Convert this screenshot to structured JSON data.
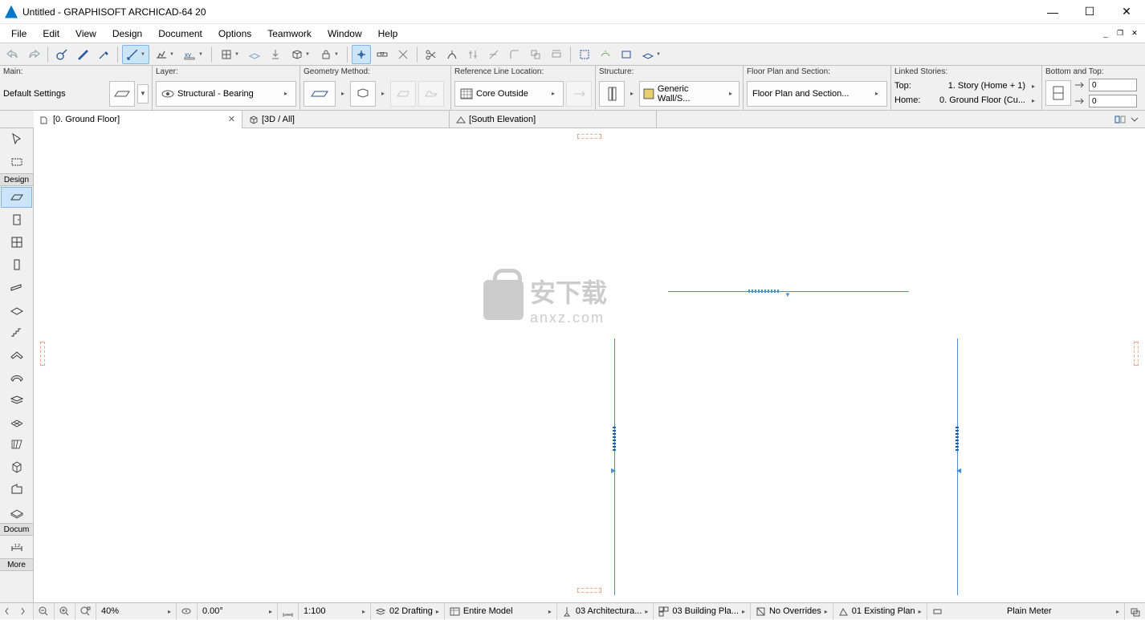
{
  "window": {
    "title": "Untitled - GRAPHISOFT ARCHICAD-64 20"
  },
  "menu": [
    "File",
    "Edit",
    "View",
    "Design",
    "Document",
    "Options",
    "Teamwork",
    "Window",
    "Help"
  ],
  "infobar": {
    "main": {
      "label": "Main:",
      "settings": "Default Settings"
    },
    "layer": {
      "label": "Layer:",
      "value": "Structural - Bearing"
    },
    "geometry": {
      "label": "Geometry Method:"
    },
    "refline": {
      "label": "Reference Line Location:",
      "value": "Core Outside"
    },
    "structure": {
      "label": "Structure:",
      "composite": "Generic Wall/S..."
    },
    "floorplan": {
      "label": "Floor Plan and Section:",
      "value": "Floor Plan and Section..."
    },
    "linked": {
      "label": "Linked Stories:",
      "top_label": "Top:",
      "top_value": "1. Story (Home + 1)",
      "home_label": "Home:",
      "home_value": "0. Ground Floor (Cu..."
    },
    "bottomtop": {
      "label": "Bottom and Top:",
      "v1": "0",
      "v2": "0"
    }
  },
  "tabs": {
    "t1": "[0. Ground Floor]",
    "t2": "[3D / All]",
    "t3": "[South Elevation]"
  },
  "toolbox": {
    "design": "Design",
    "document": "Docum",
    "more": "More"
  },
  "statusbar": {
    "zoom": "40%",
    "angle": "0.00°",
    "scale": "1:100",
    "layercombo": "02 Drafting",
    "displayopt": "Entire Model",
    "penset": "03 Architectura...",
    "mvopt": "03 Building Pla...",
    "overrides": "No Overrides",
    "renov": "01 Existing Plan",
    "dim": "Plain Meter"
  },
  "watermark": {
    "text": "安下载",
    "url": "anxz.com"
  }
}
